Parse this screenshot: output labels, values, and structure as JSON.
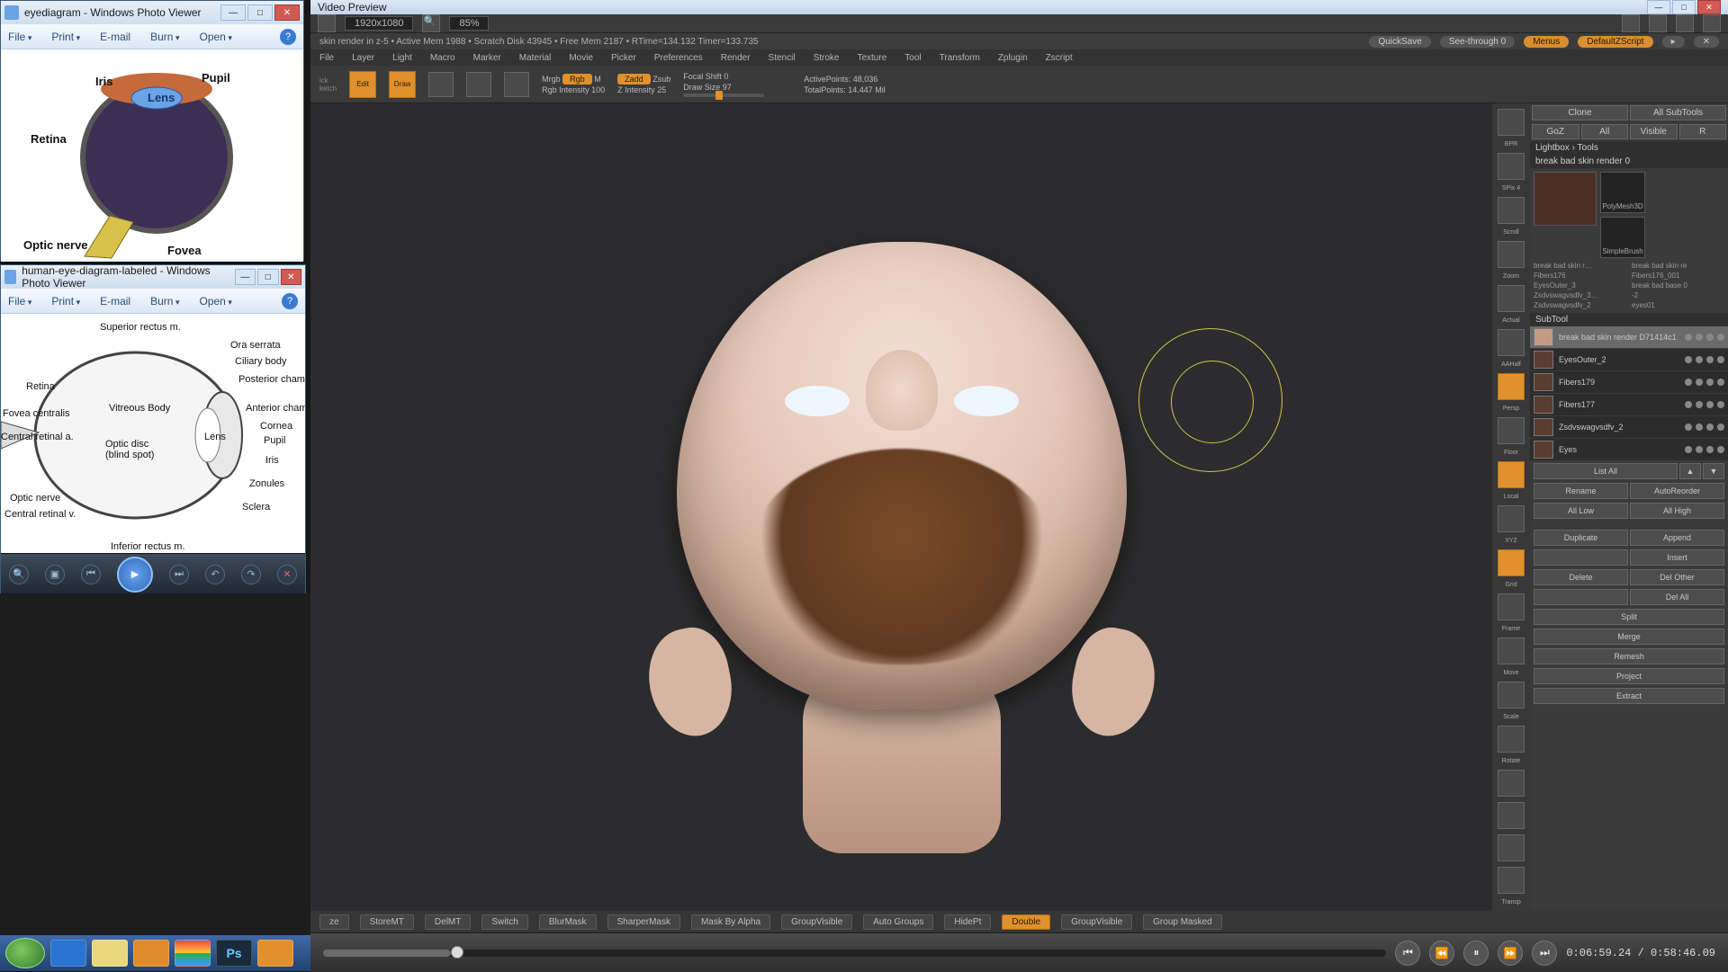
{
  "wpv1": {
    "title": "eyediagram - Windows Photo Viewer",
    "menu": {
      "file": "File",
      "print": "Print",
      "email": "E-mail",
      "burn": "Burn",
      "open": "Open"
    },
    "labels": {
      "pupil": "Pupil",
      "iris": "Iris",
      "lens": "Lens",
      "retina": "Retina",
      "optic_nerve": "Optic nerve",
      "fovea": "Fovea"
    }
  },
  "wpv2": {
    "title": "human-eye-diagram-labeled - Windows Photo Viewer",
    "menu": {
      "file": "File",
      "print": "Print",
      "email": "E-mail",
      "burn": "Burn",
      "open": "Open"
    },
    "labels": {
      "superior_rectus": "Superior rectus m.",
      "ora_serrata": "Ora serrata",
      "ciliary_body": "Ciliary body",
      "posterior_chamber": "Posterior chamber",
      "anterior_chamber": "Anterior chamber",
      "cornea": "Cornea",
      "pupil": "Pupil",
      "iris": "Iris",
      "zonules": "Zonules",
      "sclera": "Sclera",
      "inferior_rectus": "Inferior rectus m.",
      "retina": "Retina",
      "fovea_centralis": "Fovea centralis",
      "central_retinal_a": "Central retinal a.",
      "optic_nerve": "Optic nerve",
      "central_retinal_v": "Central retinal v.",
      "optic_disc": "Optic disc",
      "blind_spot": "(blind spot)",
      "vitreous_body": "Vitreous Body",
      "lens": "Lens"
    }
  },
  "vprev": {
    "title": "Video Preview",
    "res": "1920x1080",
    "zoom": "85%"
  },
  "zb": {
    "status": "skin render in z-5   •  Active Mem 1988  •  Scratch Disk 43945  •  Free Mem 2187  •  RTime=134.132  Timer=133.735",
    "topbtns": {
      "quicksave": "QuickSave",
      "seethrough": "See-through  0",
      "menus": "Menus",
      "defaultz": "DefaultZScript"
    },
    "menu": [
      "File",
      "Layer",
      "Light",
      "Macro",
      "Marker",
      "Material",
      "Movie",
      "Picker",
      "Preferences",
      "Render",
      "Stencil",
      "Stroke",
      "Texture",
      "Tool",
      "Transform",
      "Zplugin",
      "Zscript"
    ],
    "shelf": {
      "edit": "Edit",
      "draw": "Draw",
      "mrgb": "Mrgb",
      "rgb": "Rgb",
      "m": "M",
      "rgb_intensity": "Rgb Intensity 100",
      "zadd": "Zadd",
      "zsub": "Zsub",
      "z_intensity": "Z Intensity 25",
      "focal": "Focal Shift 0",
      "draw_size": "Draw Size 97",
      "active": "ActivePoints: 48,036",
      "total": "TotalPoints: 14.447 Mil"
    },
    "rstrip": [
      "BPR",
      "SPix 4",
      "Scroll",
      "Zoom",
      "Actual",
      "AAHalf",
      "Persp",
      "Floor",
      "Local",
      "XYZ",
      "Grid",
      "Frame",
      "Move",
      "Scale",
      "Rotate",
      "",
      "",
      "",
      "Transp"
    ],
    "rpanel": {
      "row1": [
        "Clone",
        "All SubTools"
      ],
      "row2": [
        "GoZ",
        "All",
        "Visible",
        "R"
      ],
      "hdr1": "Lightbox › Tools",
      "hdr2": "break bad skin render 0",
      "tools": [
        "PolyMesh3D",
        "SimpleBrush"
      ],
      "projrows": [
        "break bad skin r…",
        "break bad skin re",
        "Fibers176",
        "Fibers176_001",
        "EyesOuter_3",
        "break bad base 0",
        "Zsdvswagvsdfv_3…",
        "-2",
        "Zsdvswagvsdfv_2",
        "eyes01"
      ],
      "subtool_hdr": "SubTool",
      "subtools": [
        {
          "name": "break bad skin render  D71414c1",
          "sel": true
        },
        {
          "name": "EyesOuter_2",
          "sel": false
        },
        {
          "name": "Fibers179",
          "sel": false
        },
        {
          "name": "Fibers177",
          "sel": false
        },
        {
          "name": "Zsdvswagvsdfv_2",
          "sel": false
        },
        {
          "name": "Eyes",
          "sel": false
        }
      ],
      "listall": "List All",
      "rename": "Rename",
      "autoreorder": "AutoReorder",
      "alllow": "All Low",
      "allhigh": "All High",
      "append": "Append",
      "duplicate": "Duplicate",
      "insert": "Insert",
      "delete": "Delete",
      "delother": "Del Other",
      "delall": "Del All",
      "split": "Split",
      "merge": "Merge",
      "remesh": "Remesh",
      "project": "Project",
      "extract": "Extract"
    },
    "bbar": [
      "ze",
      "StoreMT",
      "DelMT",
      "Switch",
      "BlurMask",
      "SharperMask",
      "Mask By Alpha",
      "GroupVisible",
      "Auto Groups",
      "HidePt",
      "Double",
      "GroupVisible",
      "Group Masked"
    ],
    "player": {
      "time": "0:06:59.24 / 0:58:46.09"
    }
  }
}
